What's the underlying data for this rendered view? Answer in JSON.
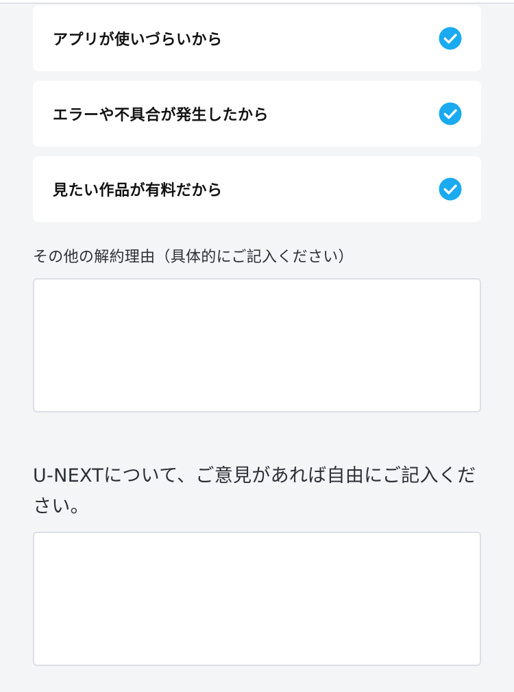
{
  "reasons": [
    {
      "label": "アプリが使いづらいから",
      "checked": true
    },
    {
      "label": "エラーや不具合が発生したから",
      "checked": true
    },
    {
      "label": "見たい作品が有料だから",
      "checked": true
    }
  ],
  "other_reason": {
    "label": "その他の解約理由（具体的にご記入ください）",
    "value": ""
  },
  "feedback": {
    "label": "U-NEXTについて、ご意見があれば自由にご記入ください。",
    "value": ""
  },
  "colors": {
    "background": "#f4f5f7",
    "check_accent": "#1aaaf0",
    "card": "#ffffff"
  },
  "icons": {
    "check": "check-circle-icon"
  }
}
